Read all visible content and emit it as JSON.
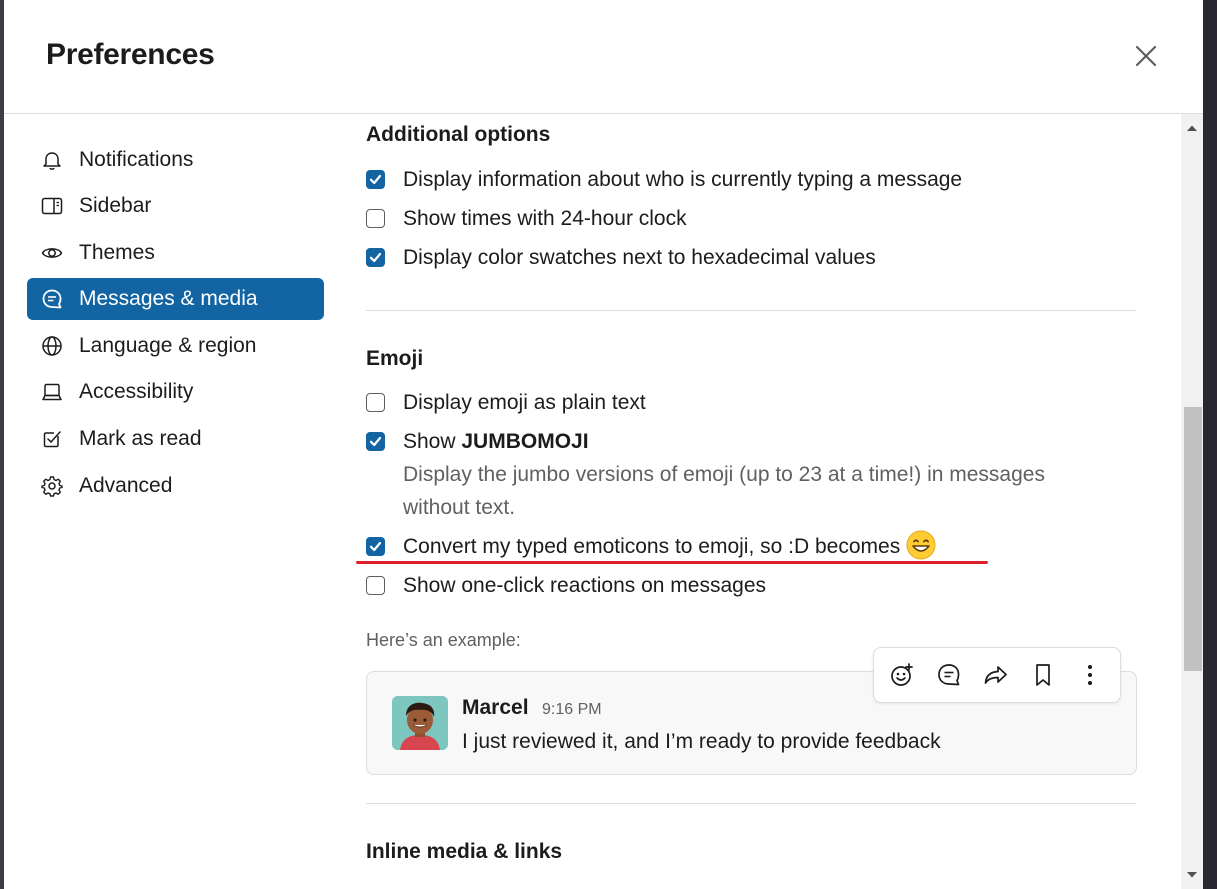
{
  "modal": {
    "title": "Preferences"
  },
  "nav": {
    "items": [
      {
        "label": "Notifications",
        "icon": "bell-icon"
      },
      {
        "label": "Sidebar",
        "icon": "sidebar-icon"
      },
      {
        "label": "Themes",
        "icon": "eye-icon"
      },
      {
        "label": "Messages & media",
        "icon": "message-icon",
        "active": true
      },
      {
        "label": "Language & region",
        "icon": "globe-icon"
      },
      {
        "label": "Accessibility",
        "icon": "laptop-icon"
      },
      {
        "label": "Mark as read",
        "icon": "check-square-icon"
      },
      {
        "label": "Advanced",
        "icon": "gear-icon"
      }
    ]
  },
  "additional": {
    "title": "Additional options",
    "options": [
      {
        "label": "Display information about who is currently typing a message",
        "checked": true
      },
      {
        "label": "Show times with 24-hour clock",
        "checked": false
      },
      {
        "label": "Display color swatches next to hexadecimal values",
        "checked": true
      }
    ]
  },
  "emoji": {
    "title": "Emoji",
    "plain_text": {
      "label": "Display emoji as plain text",
      "checked": false
    },
    "jumbo": {
      "prefix": "Show ",
      "bold": "JUMBOMOJI",
      "checked": true,
      "description": "Display the jumbo versions of emoji (up to 23 at a time!) in messages without text."
    },
    "convert": {
      "label": "Convert my typed emoticons to emoji, so :D becomes",
      "checked": true
    },
    "reactions": {
      "label": "Show one-click reactions on messages",
      "checked": false
    }
  },
  "example": {
    "label": "Here’s an example:",
    "name": "Marcel",
    "time": "9:16 PM",
    "text": "I just reviewed it, and I’m ready to provide feedback"
  },
  "inline": {
    "title": "Inline media & links"
  },
  "colors": {
    "accent": "#1264a3",
    "highlight_underline": "#e01e2b",
    "divider": "#dddddd"
  }
}
